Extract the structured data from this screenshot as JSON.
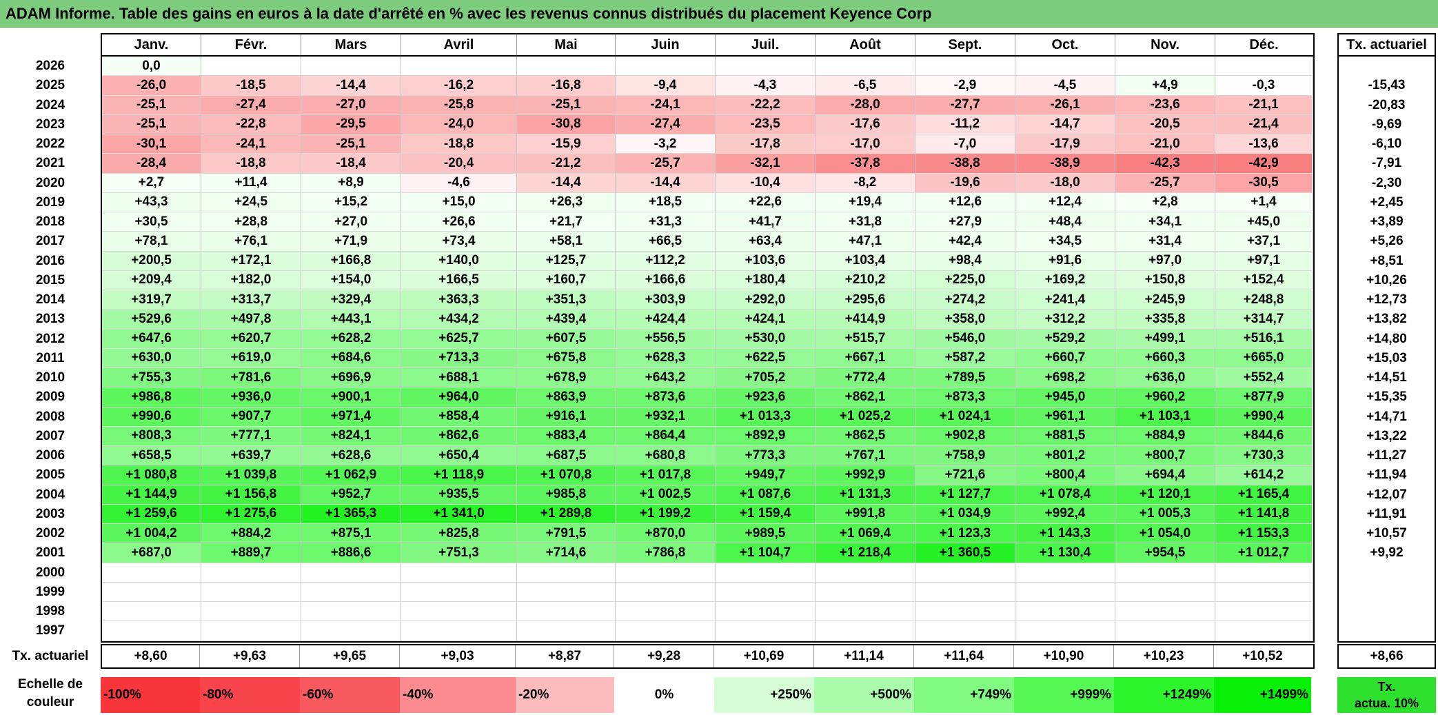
{
  "title": "ADAM Informe. Table des gains en euros à la date d'arrêté en % avec les revenus connus distribués du placement Keyence Corp",
  "months": [
    "Janv.",
    "Févr.",
    "Mars",
    "Avril",
    "Mai",
    "Juin",
    "Juil.",
    "Août",
    "Sept.",
    "Oct.",
    "Nov.",
    "Déc."
  ],
  "rate_header": "Tx. actuariel",
  "rows": [
    {
      "year": "2026",
      "values": [
        "0,0",
        "",
        "",
        "",
        "",
        "",
        "",
        "",
        "",
        "",
        "",
        ""
      ],
      "rate": ""
    },
    {
      "year": "2025",
      "values": [
        "-26,0",
        "-18,5",
        "-14,4",
        "-16,2",
        "-16,8",
        "-9,4",
        "-4,3",
        "-6,5",
        "-2,9",
        "-4,5",
        "+4,9",
        "-0,3"
      ],
      "rate": "-15,43"
    },
    {
      "year": "2024",
      "values": [
        "-25,1",
        "-27,4",
        "-27,0",
        "-25,8",
        "-25,1",
        "-24,1",
        "-22,2",
        "-28,0",
        "-27,7",
        "-26,1",
        "-23,6",
        "-21,1"
      ],
      "rate": "-20,83"
    },
    {
      "year": "2023",
      "values": [
        "-25,1",
        "-22,8",
        "-29,5",
        "-24,0",
        "-30,8",
        "-27,4",
        "-23,5",
        "-17,6",
        "-11,2",
        "-14,7",
        "-20,5",
        "-21,4"
      ],
      "rate": "-9,69"
    },
    {
      "year": "2022",
      "values": [
        "-30,1",
        "-24,1",
        "-25,1",
        "-18,8",
        "-15,9",
        "-3,2",
        "-17,8",
        "-17,0",
        "-7,0",
        "-17,9",
        "-21,0",
        "-13,6"
      ],
      "rate": "-6,10"
    },
    {
      "year": "2021",
      "values": [
        "-28,4",
        "-18,8",
        "-18,4",
        "-20,4",
        "-21,2",
        "-25,7",
        "-32,1",
        "-37,8",
        "-38,8",
        "-38,9",
        "-42,3",
        "-42,9"
      ],
      "rate": "-7,91"
    },
    {
      "year": "2020",
      "values": [
        "+2,7",
        "+11,4",
        "+8,9",
        "-4,6",
        "-14,4",
        "-14,4",
        "-10,4",
        "-8,2",
        "-19,6",
        "-18,0",
        "-25,7",
        "-30,5"
      ],
      "rate": "-2,30"
    },
    {
      "year": "2019",
      "values": [
        "+43,3",
        "+24,5",
        "+15,2",
        "+15,0",
        "+26,3",
        "+18,5",
        "+22,6",
        "+19,4",
        "+12,6",
        "+12,4",
        "+2,8",
        "+1,4"
      ],
      "rate": "+2,45"
    },
    {
      "year": "2018",
      "values": [
        "+30,5",
        "+28,8",
        "+27,0",
        "+26,6",
        "+21,7",
        "+31,3",
        "+41,7",
        "+31,8",
        "+27,9",
        "+48,4",
        "+34,1",
        "+45,0"
      ],
      "rate": "+3,89"
    },
    {
      "year": "2017",
      "values": [
        "+78,1",
        "+76,1",
        "+71,9",
        "+73,4",
        "+58,1",
        "+66,5",
        "+63,4",
        "+47,1",
        "+42,4",
        "+34,5",
        "+31,4",
        "+37,1"
      ],
      "rate": "+5,26"
    },
    {
      "year": "2016",
      "values": [
        "+200,5",
        "+172,1",
        "+166,8",
        "+140,0",
        "+125,7",
        "+112,2",
        "+103,6",
        "+103,4",
        "+98,4",
        "+91,6",
        "+97,0",
        "+97,1"
      ],
      "rate": "+8,51"
    },
    {
      "year": "2015",
      "values": [
        "+209,4",
        "+182,0",
        "+154,0",
        "+166,5",
        "+160,7",
        "+166,6",
        "+180,4",
        "+210,2",
        "+225,0",
        "+169,2",
        "+150,8",
        "+152,4"
      ],
      "rate": "+10,26"
    },
    {
      "year": "2014",
      "values": [
        "+319,7",
        "+313,7",
        "+329,4",
        "+363,3",
        "+351,3",
        "+303,9",
        "+292,0",
        "+295,6",
        "+274,2",
        "+241,4",
        "+245,9",
        "+248,8"
      ],
      "rate": "+12,73"
    },
    {
      "year": "2013",
      "values": [
        "+529,6",
        "+497,8",
        "+443,1",
        "+434,2",
        "+439,4",
        "+424,4",
        "+424,1",
        "+414,9",
        "+358,0",
        "+312,2",
        "+335,8",
        "+314,7"
      ],
      "rate": "+13,82"
    },
    {
      "year": "2012",
      "values": [
        "+647,6",
        "+620,7",
        "+628,2",
        "+625,7",
        "+607,5",
        "+556,5",
        "+530,0",
        "+515,7",
        "+546,0",
        "+529,2",
        "+499,1",
        "+516,1"
      ],
      "rate": "+14,80"
    },
    {
      "year": "2011",
      "values": [
        "+630,0",
        "+619,0",
        "+684,6",
        "+713,3",
        "+675,8",
        "+628,3",
        "+622,5",
        "+667,1",
        "+587,2",
        "+660,7",
        "+660,3",
        "+665,0"
      ],
      "rate": "+15,03"
    },
    {
      "year": "2010",
      "values": [
        "+755,3",
        "+781,6",
        "+696,9",
        "+688,1",
        "+678,9",
        "+643,2",
        "+705,2",
        "+772,4",
        "+789,5",
        "+698,2",
        "+636,0",
        "+552,4"
      ],
      "rate": "+14,51"
    },
    {
      "year": "2009",
      "values": [
        "+986,8",
        "+936,0",
        "+900,1",
        "+964,0",
        "+863,9",
        "+873,6",
        "+923,6",
        "+862,1",
        "+873,3",
        "+945,0",
        "+960,2",
        "+877,9"
      ],
      "rate": "+15,35"
    },
    {
      "year": "2008",
      "values": [
        "+990,6",
        "+907,7",
        "+971,4",
        "+858,4",
        "+916,1",
        "+932,1",
        "+1 013,3",
        "+1 025,2",
        "+1 024,1",
        "+961,1",
        "+1 103,1",
        "+990,4"
      ],
      "rate": "+14,71"
    },
    {
      "year": "2007",
      "values": [
        "+808,3",
        "+777,1",
        "+824,1",
        "+862,6",
        "+883,4",
        "+864,4",
        "+892,9",
        "+862,5",
        "+902,8",
        "+881,5",
        "+884,9",
        "+844,6"
      ],
      "rate": "+13,22"
    },
    {
      "year": "2006",
      "values": [
        "+658,5",
        "+639,7",
        "+628,6",
        "+650,4",
        "+687,5",
        "+680,8",
        "+773,3",
        "+767,1",
        "+758,9",
        "+801,2",
        "+800,7",
        "+730,3"
      ],
      "rate": "+11,27"
    },
    {
      "year": "2005",
      "values": [
        "+1 080,8",
        "+1 039,8",
        "+1 062,9",
        "+1 118,9",
        "+1 070,8",
        "+1 017,8",
        "+949,7",
        "+992,9",
        "+721,6",
        "+800,4",
        "+694,4",
        "+614,2"
      ],
      "rate": "+11,94"
    },
    {
      "year": "2004",
      "values": [
        "+1 144,9",
        "+1 156,8",
        "+952,7",
        "+935,5",
        "+985,8",
        "+1 002,5",
        "+1 087,6",
        "+1 131,3",
        "+1 127,7",
        "+1 078,4",
        "+1 120,1",
        "+1 165,4"
      ],
      "rate": "+12,07"
    },
    {
      "year": "2003",
      "values": [
        "+1 259,6",
        "+1 275,6",
        "+1 365,3",
        "+1 341,0",
        "+1 289,8",
        "+1 199,2",
        "+1 159,4",
        "+991,8",
        "+1 034,9",
        "+992,4",
        "+1 005,3",
        "+1 141,8"
      ],
      "rate": "+11,91"
    },
    {
      "year": "2002",
      "values": [
        "+1 004,2",
        "+884,2",
        "+875,1",
        "+825,8",
        "+791,5",
        "+870,0",
        "+989,5",
        "+1 069,4",
        "+1 123,3",
        "+1 143,3",
        "+1 054,0",
        "+1 153,3"
      ],
      "rate": "+10,57"
    },
    {
      "year": "2001",
      "values": [
        "+687,0",
        "+889,7",
        "+886,6",
        "+751,3",
        "+714,6",
        "+786,8",
        "+1 104,7",
        "+1 218,4",
        "+1 360,5",
        "+1 130,4",
        "+954,5",
        "+1 012,7"
      ],
      "rate": "+9,92"
    },
    {
      "year": "2000",
      "values": [
        "",
        "",
        "",
        "",
        "",
        "",
        "",
        "",
        "",
        "",
        "",
        ""
      ],
      "rate": ""
    },
    {
      "year": "1999",
      "values": [
        "",
        "",
        "",
        "",
        "",
        "",
        "",
        "",
        "",
        "",
        "",
        ""
      ],
      "rate": ""
    },
    {
      "year": "1998",
      "values": [
        "",
        "",
        "",
        "",
        "",
        "",
        "",
        "",
        "",
        "",
        "",
        ""
      ],
      "rate": ""
    },
    {
      "year": "1997",
      "values": [
        "",
        "",
        "",
        "",
        "",
        "",
        "",
        "",
        "",
        "",
        "",
        ""
      ],
      "rate": ""
    }
  ],
  "totals": {
    "label": "Tx. actuariel",
    "values": [
      "+8,60",
      "+9,63",
      "+9,65",
      "+9,03",
      "+8,87",
      "+9,28",
      "+10,69",
      "+11,14",
      "+11,64",
      "+10,90",
      "+10,23",
      "+10,52"
    ],
    "rate": "+8,66"
  },
  "scale": {
    "label_line1": "Echelle de",
    "label_line2": "couleur",
    "steps": [
      {
        "text": "-100%",
        "color": "#f8353b",
        "align": "left"
      },
      {
        "text": "-80%",
        "color": "#f8444a",
        "align": "left"
      },
      {
        "text": "-60%",
        "color": "#f85a5f",
        "align": "left"
      },
      {
        "text": "-40%",
        "color": "#fb8b8e",
        "align": "left"
      },
      {
        "text": "-20%",
        "color": "#fcbcbe",
        "align": "left"
      },
      {
        "text": "0%",
        "color": "#ffffff",
        "align": "center"
      },
      {
        "text": "+250%",
        "color": "#d5fcd5",
        "align": "right"
      },
      {
        "text": "+500%",
        "color": "#aafbaa",
        "align": "right"
      },
      {
        "text": "+749%",
        "color": "#80fa80",
        "align": "right"
      },
      {
        "text": "+999%",
        "color": "#55f855",
        "align": "right"
      },
      {
        "text": "+1249%",
        "color": "#2cf52c",
        "align": "right"
      },
      {
        "text": "+1499%",
        "color": "#08f008",
        "align": "right"
      }
    ],
    "tx_line1": "Tx.",
    "tx_line2": "actua. 10%"
  },
  "colors": {
    "title_bg": "#7dcb7d",
    "negative_max": "#f8696b",
    "positive_max": "#1ef21e"
  }
}
